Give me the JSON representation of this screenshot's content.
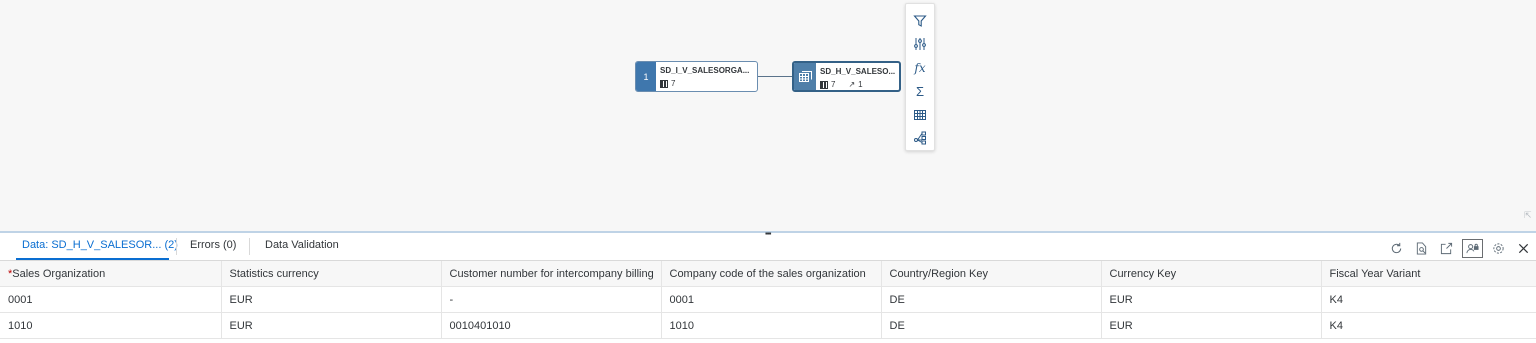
{
  "graph": {
    "node1": {
      "badge": "1",
      "title": "SD_I_V_SALESORGA...",
      "columns": "7"
    },
    "node2": {
      "title": "SD_H_V_SALESO...",
      "columns": "7",
      "links": "1"
    }
  },
  "toolbar": {
    "tools": [
      "filter-icon",
      "adjust-icon",
      "function-icon",
      "sum-icon",
      "table-icon",
      "hierarchy-icon"
    ],
    "fx_label": "fx",
    "sigma_label": "Σ"
  },
  "panel": {
    "tabs": [
      {
        "label": "Data: SD_H_V_SALESOR... (2)"
      },
      {
        "label": "Errors (0)"
      },
      {
        "label": "Data Validation"
      }
    ],
    "actions": [
      "refresh-icon",
      "preview-icon",
      "export-icon",
      "user-lock-icon",
      "settings-icon",
      "close-icon"
    ]
  },
  "table": {
    "required_marker": "*",
    "headers": [
      "Sales Organization",
      "Statistics currency",
      "Customer number for intercompany billing",
      "Company code of the sales organization",
      "Country/Region Key",
      "Currency Key",
      "Fiscal Year Variant"
    ],
    "rows": [
      [
        "0001",
        "EUR",
        "-",
        "0001",
        "DE",
        "EUR",
        "K4"
      ],
      [
        "1010",
        "EUR",
        "0010401010",
        "1010",
        "DE",
        "EUR",
        "K4"
      ]
    ]
  },
  "colors": {
    "accent": "#0a6ed1",
    "node_header": "#3f77ad",
    "required": "#bb0000"
  }
}
